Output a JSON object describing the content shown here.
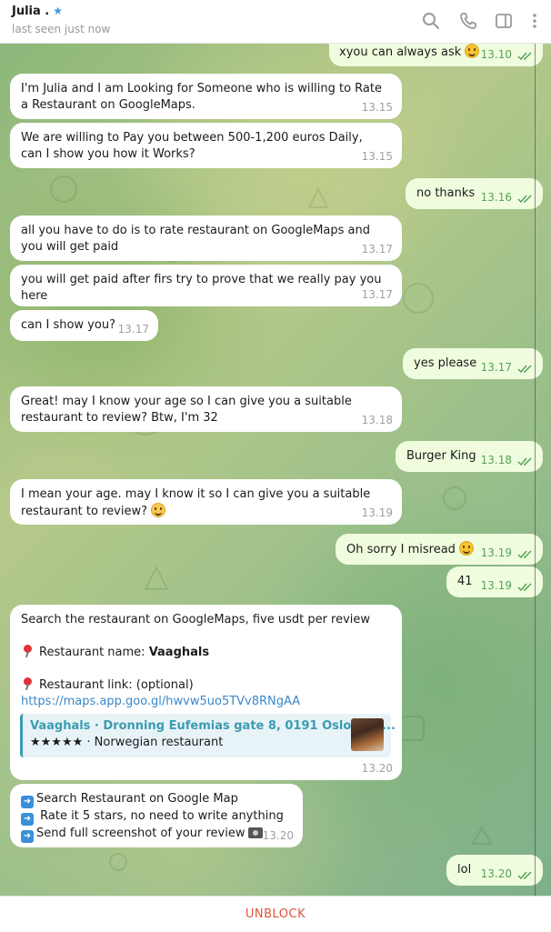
{
  "header": {
    "name": "Julia .",
    "status": "last seen just now"
  },
  "messages": {
    "m1": {
      "text": "xyou can always ask",
      "time": "13.10"
    },
    "m2": {
      "text": "I'm Julia and I am Looking for Someone who is willing to Rate a Restaurant on GoogleMaps.",
      "time": "13.15"
    },
    "m3": {
      "text": "We are willing to Pay you between 500-1,200 euros Daily, can I show you how it Works?",
      "time": "13.15"
    },
    "m4": {
      "text": "no thanks",
      "time": "13.16"
    },
    "m5": {
      "text": "all you have to do is to rate restaurant on GoogleMaps and you will get paid",
      "time": "13.17"
    },
    "m6": {
      "text": "you will get paid after firs try to prove that we really pay you here",
      "time": "13.17"
    },
    "m7": {
      "text": "can I show you?",
      "time": "13.17"
    },
    "m8": {
      "text": "yes please",
      "time": "13.17"
    },
    "m9": {
      "text": "Great! may I know your age so I can give you a suitable restaurant to review? Btw, I'm 32",
      "time": "13.18"
    },
    "m10": {
      "text": "Burger King",
      "time": "13.18"
    },
    "m11": {
      "text": "I mean your age. may I know it so I can give you a suitable restaurant to review?",
      "time": "13.19"
    },
    "m12": {
      "text": "Oh sorry I misread",
      "time": "13.19"
    },
    "m13": {
      "text": "41",
      "time": "13.19"
    },
    "m14": {
      "line1": "Search the restaurant on GoogleMaps, five usdt per review",
      "name_label": "Restaurant name: ",
      "name_value": "Vaaghals",
      "link_label": "Restaurant link: (optional)",
      "link": "https://maps.app.goo.gl/hwvw5uo5TVv8RNgAA",
      "preview_title": "Vaaghals · Dronning Eufemias gate 8, 0191 Oslo, Nor...",
      "preview_sub": "★★★★★ · Norwegian restaurant",
      "time": "13.20"
    },
    "m15": {
      "line1": "Search Restaurant on Google Map",
      "line2": " Rate it 5 stars, no need to write anything",
      "line3": "Send full screenshot of your review",
      "time": "13.20"
    },
    "m16": {
      "text": "lol",
      "time": "13.20"
    }
  },
  "footer": {
    "unblock": "UNBLOCK"
  }
}
